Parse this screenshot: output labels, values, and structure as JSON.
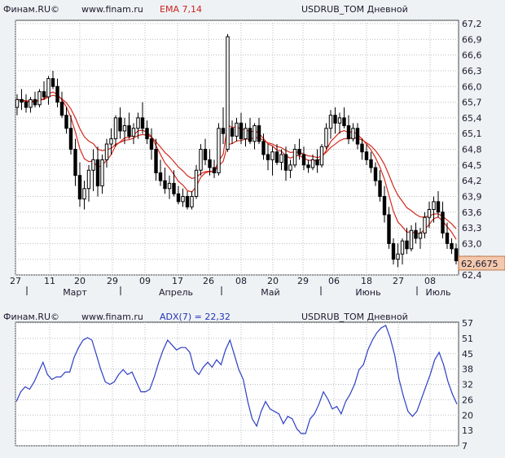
{
  "top_header": {
    "source": "Финам.RU©",
    "url": "www.finam.ru",
    "indicator": "EMA 7,14",
    "instrument": "USDRUB_TOM Дневной"
  },
  "bottom_header": {
    "source": "Финам.RU©",
    "url": "www.finam.ru",
    "indicator": "ADX(7) = 22,32",
    "instrument": "USDRUB_TOM Дневной"
  },
  "colors": {
    "background": "#eff2f4",
    "plot": "#ffffff",
    "grid": "#b9bdc3",
    "candle": "#000000",
    "ema": "#d42a1e",
    "adx": "#2d3ec4",
    "indicator_text_top": "#cc2222",
    "indicator_text_bottom": "#2233bb",
    "last_price_box": "#f3c8ad"
  },
  "chart_data": [
    {
      "type": "candlestick",
      "title": "USDRUB_TOM Дневной",
      "y_ticks": [
        "67,2",
        "66,9",
        "66,6",
        "66,3",
        "66,0",
        "65,7",
        "65,4",
        "65,1",
        "64,8",
        "64,5",
        "64,2",
        "63,9",
        "63,6",
        "63,3",
        "63,0",
        "62,7",
        "62,4"
      ],
      "ylim": [
        62.4,
        67.2
      ],
      "last_price": "62,6675",
      "day_ticks": [
        "27",
        "11",
        "20",
        "29",
        "09",
        "17",
        "26",
        "08",
        "20",
        "29",
        "06",
        "18",
        "27",
        "08"
      ],
      "month_labels": [
        "Март",
        "Апрель",
        "Май",
        "Июнь",
        "Июль"
      ],
      "series": [
        {
          "name": "USDRUB_TOM",
          "ohlc": [
            [
              65.6,
              65.85,
              65.45,
              65.75
            ],
            [
              65.75,
              65.95,
              65.55,
              65.7
            ],
            [
              65.7,
              65.85,
              65.5,
              65.6
            ],
            [
              65.6,
              65.8,
              65.5,
              65.75
            ],
            [
              65.75,
              65.9,
              65.6,
              65.65
            ],
            [
              65.65,
              65.95,
              65.6,
              65.9
            ],
            [
              65.9,
              66.1,
              65.75,
              65.8
            ],
            [
              65.8,
              66.2,
              65.65,
              66.15
            ],
            [
              66.15,
              66.3,
              65.95,
              66.0
            ],
            [
              66.0,
              66.15,
              65.6,
              65.7
            ],
            [
              65.7,
              65.9,
              65.4,
              65.45
            ],
            [
              65.45,
              65.6,
              65.1,
              65.2
            ],
            [
              65.2,
              65.45,
              64.7,
              64.8
            ],
            [
              64.8,
              65.0,
              64.1,
              64.3
            ],
            [
              64.3,
              64.55,
              63.7,
              63.85
            ],
            [
              63.85,
              64.2,
              63.65,
              64.05
            ],
            [
              64.05,
              64.5,
              63.8,
              64.4
            ],
            [
              64.4,
              64.8,
              64.0,
              64.6
            ],
            [
              64.6,
              64.85,
              63.9,
              64.1
            ],
            [
              64.1,
              64.7,
              63.95,
              64.6
            ],
            [
              64.6,
              65.0,
              64.45,
              64.9
            ],
            [
              64.9,
              65.2,
              64.7,
              65.0
            ],
            [
              65.0,
              65.45,
              64.85,
              65.4
            ],
            [
              65.4,
              65.6,
              65.0,
              65.15
            ],
            [
              65.15,
              65.4,
              64.9,
              65.25
            ],
            [
              65.25,
              65.5,
              65.0,
              65.05
            ],
            [
              65.05,
              65.3,
              64.9,
              65.2
            ],
            [
              65.2,
              65.5,
              65.0,
              65.4
            ],
            [
              65.4,
              65.7,
              65.1,
              65.2
            ],
            [
              65.2,
              65.35,
              64.9,
              65.0
            ],
            [
              65.0,
              65.2,
              64.6,
              64.8
            ],
            [
              64.8,
              65.0,
              64.2,
              64.35
            ],
            [
              64.35,
              64.6,
              64.1,
              64.2
            ],
            [
              64.2,
              64.45,
              63.95,
              64.05
            ],
            [
              64.05,
              64.3,
              63.85,
              64.15
            ],
            [
              64.15,
              64.4,
              63.9,
              63.95
            ],
            [
              63.95,
              64.1,
              63.75,
              63.8
            ],
            [
              63.8,
              64.05,
              63.7,
              63.9
            ],
            [
              63.9,
              64.0,
              63.65,
              63.7
            ],
            [
              63.7,
              64.0,
              63.65,
              63.9
            ],
            [
              63.9,
              64.5,
              63.85,
              64.4
            ],
            [
              64.4,
              64.9,
              64.3,
              64.8
            ],
            [
              64.8,
              65.0,
              64.5,
              64.6
            ],
            [
              64.6,
              64.8,
              64.3,
              64.45
            ],
            [
              64.45,
              64.6,
              64.25,
              64.35
            ],
            [
              64.35,
              65.3,
              64.3,
              65.2
            ],
            [
              65.2,
              65.6,
              64.9,
              65.1
            ],
            [
              64.8,
              67.0,
              64.75,
              66.95
            ],
            [
              65.2,
              65.35,
              64.9,
              65.05
            ],
            [
              65.05,
              65.4,
              64.95,
              65.3
            ],
            [
              65.3,
              65.5,
              64.9,
              65.0
            ],
            [
              65.0,
              65.3,
              64.85,
              65.2
            ],
            [
              65.2,
              65.4,
              64.9,
              64.95
            ],
            [
              64.95,
              65.3,
              64.8,
              65.25
            ],
            [
              65.25,
              65.4,
              64.9,
              64.95
            ],
            [
              64.95,
              65.1,
              64.6,
              64.7
            ],
            [
              64.7,
              64.9,
              64.4,
              64.6
            ],
            [
              64.6,
              64.85,
              64.3,
              64.75
            ],
            [
              64.75,
              64.9,
              64.5,
              64.55
            ],
            [
              64.55,
              64.8,
              64.4,
              64.7
            ],
            [
              64.7,
              64.85,
              64.2,
              64.4
            ],
            [
              64.4,
              64.6,
              64.25,
              64.5
            ],
            [
              64.5,
              64.9,
              64.45,
              64.8
            ],
            [
              64.8,
              65.0,
              64.6,
              64.7
            ],
            [
              64.7,
              64.85,
              64.4,
              64.5
            ],
            [
              64.5,
              64.6,
              64.35,
              64.45
            ],
            [
              64.45,
              64.7,
              64.4,
              64.6
            ],
            [
              64.6,
              64.8,
              64.35,
              64.5
            ],
            [
              64.5,
              64.9,
              64.45,
              64.85
            ],
            [
              64.85,
              65.3,
              64.8,
              65.2
            ],
            [
              65.2,
              65.55,
              65.0,
              65.45
            ],
            [
              65.45,
              65.6,
              65.1,
              65.3
            ],
            [
              65.3,
              65.5,
              65.1,
              65.4
            ],
            [
              65.4,
              65.6,
              65.2,
              65.25
            ],
            [
              65.25,
              65.45,
              64.9,
              65.0
            ],
            [
              65.0,
              65.3,
              64.95,
              65.2
            ],
            [
              65.2,
              65.3,
              64.8,
              64.9
            ],
            [
              64.9,
              65.0,
              64.6,
              64.75
            ],
            [
              64.75,
              64.9,
              64.5,
              64.6
            ],
            [
              64.6,
              64.75,
              64.35,
              64.45
            ],
            [
              64.45,
              64.55,
              64.1,
              64.2
            ],
            [
              64.2,
              64.4,
              63.8,
              63.9
            ],
            [
              63.9,
              64.1,
              63.4,
              63.55
            ],
            [
              63.55,
              63.7,
              62.9,
              63.0
            ],
            [
              63.0,
              63.1,
              62.6,
              62.7
            ],
            [
              62.7,
              63.0,
              62.55,
              62.8
            ],
            [
              62.8,
              63.1,
              62.6,
              63.05
            ],
            [
              63.05,
              63.3,
              62.8,
              62.9
            ],
            [
              62.9,
              63.35,
              62.85,
              63.25
            ],
            [
              63.25,
              63.4,
              63.0,
              63.1
            ],
            [
              63.1,
              63.3,
              62.9,
              63.2
            ],
            [
              63.2,
              63.6,
              63.1,
              63.5
            ],
            [
              63.5,
              63.8,
              63.3,
              63.65
            ],
            [
              63.65,
              63.9,
              63.4,
              63.8
            ],
            [
              63.8,
              64.0,
              63.5,
              63.6
            ],
            [
              63.6,
              63.8,
              63.1,
              63.2
            ],
            [
              63.2,
              63.4,
              62.9,
              63.0
            ],
            [
              63.0,
              63.1,
              62.8,
              62.9
            ],
            [
              62.9,
              63.0,
              62.6,
              62.67
            ]
          ]
        },
        {
          "name": "EMA 7",
          "style": "line"
        },
        {
          "name": "EMA 14",
          "style": "line"
        }
      ]
    },
    {
      "type": "line",
      "title": "ADX(7) = 22,32",
      "y_ticks": [
        "57",
        "51",
        "45",
        "38",
        "32",
        "26",
        "20",
        "13",
        "7"
      ],
      "ylim": [
        7,
        57
      ],
      "series": [
        {
          "name": "ADX(7)",
          "values": [
            25,
            29,
            31,
            30,
            33,
            37,
            41,
            36,
            34,
            35,
            35,
            37,
            37,
            43,
            47,
            50,
            51,
            50,
            44,
            38,
            33,
            32,
            33,
            36,
            38,
            36,
            37,
            33,
            29,
            29,
            30,
            35,
            41,
            46,
            50,
            48,
            46,
            47,
            47,
            45,
            38,
            36,
            39,
            41,
            39,
            42,
            40,
            46,
            50,
            44,
            38,
            34,
            25,
            18,
            15,
            21,
            25,
            22,
            21,
            20,
            16,
            19,
            18,
            14,
            12,
            12,
            18,
            20,
            24,
            29,
            26,
            22,
            23,
            20,
            25,
            28,
            32,
            38,
            40,
            46,
            50,
            53,
            55,
            56,
            51,
            44,
            34,
            27,
            21,
            19,
            21,
            26,
            31,
            36,
            42,
            45,
            40,
            33,
            28,
            24
          ]
        }
      ]
    }
  ]
}
